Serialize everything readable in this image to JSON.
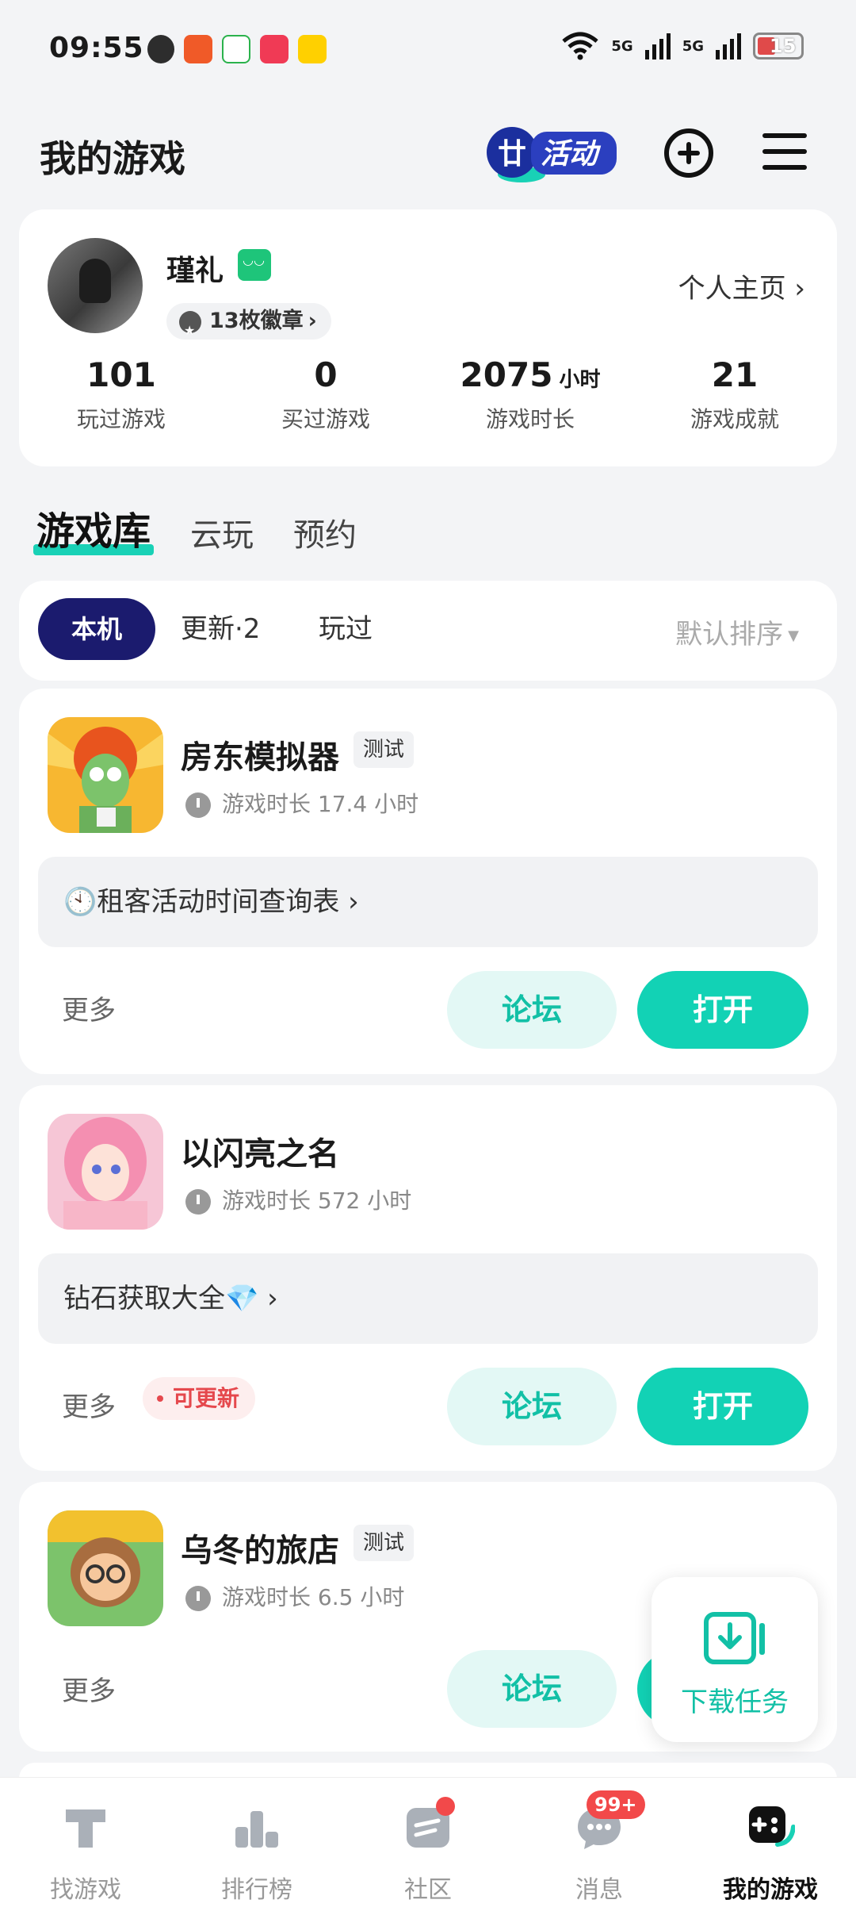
{
  "status_bar": {
    "time": "09:55",
    "signal_1": "5G",
    "signal_2": "5G",
    "battery": "15",
    "app_icons": [
      "wechat-icon",
      "video-app-icon",
      "tencent-video-icon",
      "music-app-icon",
      "meituan-icon"
    ]
  },
  "header": {
    "title": "我的游戏",
    "activity_logo_text": "活动"
  },
  "profile": {
    "username": "瑾礼",
    "badges": "13枚徽章",
    "home_link": "个人主页",
    "stats": [
      {
        "value": "101",
        "unit": "",
        "label": "玩过游戏"
      },
      {
        "value": "0",
        "unit": "",
        "label": "买过游戏"
      },
      {
        "value": "2075",
        "unit": "小时",
        "label": "游戏时长"
      },
      {
        "value": "21",
        "unit": "",
        "label": "游戏成就"
      }
    ]
  },
  "tabs": [
    "游戏库",
    "云玩",
    "预约"
  ],
  "filters": {
    "chips": [
      "本机",
      "更新·2",
      "玩过"
    ],
    "sort": "默认排序"
  },
  "games": [
    {
      "name": "房东模拟器",
      "tag": "测试",
      "playtime": "游戏时长 17.4 小时",
      "tip": "🕙租客活动时间查询表",
      "more": "更多",
      "update": "",
      "forum": "论坛",
      "open": "打开"
    },
    {
      "name": "以闪亮之名",
      "tag": "",
      "playtime": "游戏时长 572 小时",
      "tip": "钻石获取大全💎",
      "more": "更多",
      "update": "可更新",
      "forum": "论坛",
      "open": "打开"
    },
    {
      "name": "乌冬的旅店",
      "tag": "测试",
      "playtime": "游戏时长 6.5 小时",
      "tip": "",
      "more": "更多",
      "update": "",
      "forum": "论坛",
      "open": "打开"
    }
  ],
  "download_task": "下载任务",
  "bottom_nav": [
    {
      "label": "找游戏",
      "icon": "find-game-icon"
    },
    {
      "label": "排行榜",
      "icon": "ranking-icon"
    },
    {
      "label": "社区",
      "icon": "community-icon",
      "dot": true
    },
    {
      "label": "消息",
      "icon": "message-icon",
      "badge": "99+"
    },
    {
      "label": "我的游戏",
      "icon": "gamepad-icon",
      "active": true
    }
  ],
  "colors": {
    "accent": "#12d2b5",
    "chip_active": "#1b1b6e",
    "update_red": "#e5484d"
  }
}
